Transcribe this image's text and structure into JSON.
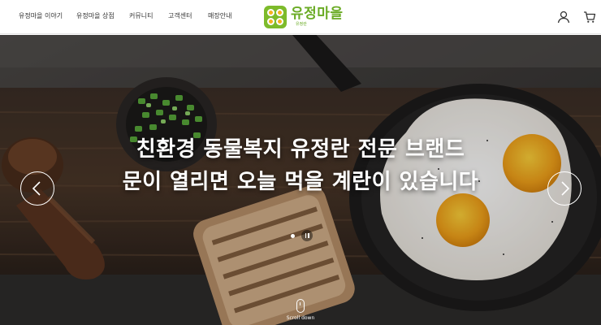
{
  "nav": {
    "items": [
      {
        "label": "유정마을 이야기"
      },
      {
        "label": "유정마을 상점"
      },
      {
        "label": "커뮤니티"
      },
      {
        "label": "고객센터"
      },
      {
        "label": "매장안내"
      }
    ]
  },
  "logo": {
    "title": "유정마을",
    "subtitle": "유정란"
  },
  "header_icons": {
    "user": "user-icon",
    "cart": "cart-icon"
  },
  "hero": {
    "line1": "친환경 동물복지 유정란 전문 브랜드",
    "line2": "문이 열리면 오늘 먹을 계란이 있습니다",
    "prev_icon": "chevron-left-icon",
    "next_icon": "chevron-right-icon",
    "scroll_label": "Scroll down",
    "slide_count": 1,
    "current_slide": 1
  },
  "colors": {
    "brand_green": "#7dbb2b",
    "brand_yellow": "#f3b21d",
    "text_dark": "#333333"
  }
}
